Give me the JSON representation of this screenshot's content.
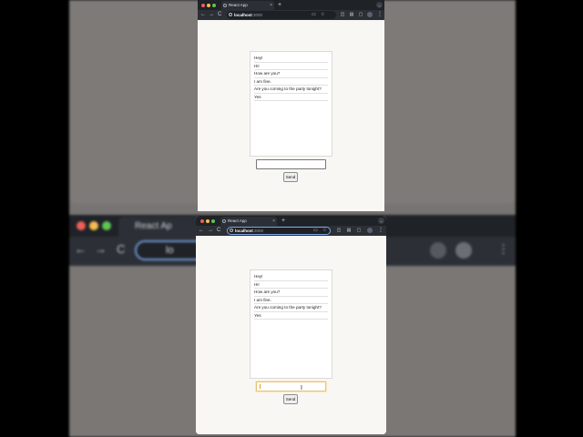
{
  "browser": {
    "tab_title": "React App",
    "url_host": "localhost",
    "url_port": ":3000",
    "new_tab_symbol": "+",
    "close_symbol": "×",
    "back_symbol": "←",
    "forward_symbol": "→",
    "reload_symbol": "C",
    "menu_symbol": "⋮",
    "tab_menu_symbol": "⌄",
    "star_symbol": "☆",
    "profile_letter": "V"
  },
  "background_blur": {
    "tab_title": "React Ap",
    "url_text": "lo",
    "traffic_light_colors": [
      "#ee5f57",
      "#f5bd4f",
      "#5fc454"
    ]
  },
  "chat": {
    "messages": [
      "Hey!",
      "Hi!",
      "How are you?",
      "I am fine.",
      "Are you coming to the party tonight?",
      "Yes"
    ],
    "input_value": "",
    "send_label": "Send"
  },
  "colors": {
    "page_bg": "#f9f7f4",
    "chrome_dark": "#1f2227",
    "toolbar": "#2c3036",
    "focus_ring": "#e8c170",
    "url_focus": "#7ca7e6"
  }
}
